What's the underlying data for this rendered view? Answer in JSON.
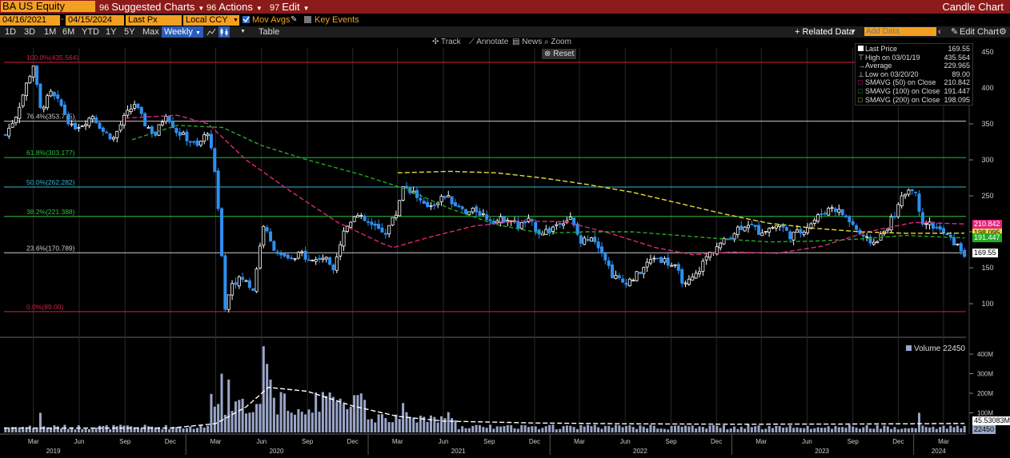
{
  "toolbar": {
    "ticker": "BA US Equity",
    "suggested_charts": "Suggested Charts",
    "suggested_num": "96",
    "actions": "Actions",
    "actions_num": "96",
    "edit": "Edit",
    "edit_num": "97",
    "chart_type": "Candle Chart"
  },
  "params": {
    "start_date": "04/16/2021",
    "end_date": "04/15/2024",
    "price_field": "Last Px",
    "currency": "Local CCY",
    "mov_avgs": "Mov Avgs",
    "key_events": "Key Events"
  },
  "ranges": [
    "1D",
    "3D",
    "1M",
    "6M",
    "YTD",
    "1Y",
    "5Y",
    "Max"
  ],
  "period": "Weekly",
  "table_label": "Table",
  "related_data": "+ Related Data",
  "add_data_placeholder": "Add Data",
  "edit_chart": "Edit Chart",
  "chart_tools": [
    "Track",
    "Annotate",
    "News",
    "Zoom"
  ],
  "reset_label": "Reset",
  "legend": {
    "last_price": {
      "label": "Last Price",
      "value": "169.55"
    },
    "high": {
      "label": "High on 03/01/19",
      "value": "435.564"
    },
    "average": {
      "label": "Average",
      "value": "229.965"
    },
    "low": {
      "label": "Low on 03/20/20",
      "value": "89.00"
    },
    "sma50": {
      "label": "SMAVG (50)  on Close",
      "value": "210.842",
      "color": "#e0267d"
    },
    "sma100": {
      "label": "SMAVG (100)  on Close",
      "value": "191.447",
      "color": "#22aa22"
    },
    "sma200": {
      "label": "SMAVG (200)  on Close",
      "value": "198.095",
      "color": "#e8d840"
    }
  },
  "volume_legend": {
    "label": "Volume",
    "value": "22450"
  },
  "price_badges": {
    "sma50": "210.842",
    "sma200": "198.095",
    "sma100": "191.447",
    "last": "169.55"
  },
  "volume_badges": {
    "avg": "45.53083M",
    "last": "22450"
  },
  "colors": {
    "up": "#ffffff",
    "down": "#2f8ff0",
    "topbar": "#8b1a1a",
    "accent": "#f3a021"
  },
  "chart_data": {
    "type": "candlestick",
    "frequency": "weekly",
    "x_range": [
      "2019-01-01",
      "2024-04-15"
    ],
    "ylim": [
      70,
      460
    ],
    "y_ticks": [
      100,
      150,
      200,
      250,
      300,
      350,
      400,
      450
    ],
    "volume_ticks": [
      "100M",
      "200M",
      "300M",
      "400M"
    ],
    "volume_ylim_millions": [
      0,
      450
    ],
    "x_month_ticks": [
      "Mar",
      "Jun",
      "Sep",
      "Dec",
      "Mar",
      "Jun",
      "Sep",
      "Dec",
      "Mar",
      "Jun",
      "Sep",
      "Dec",
      "Mar",
      "Jun",
      "Sep",
      "Dec",
      "Mar",
      "Jun",
      "Sep",
      "Dec",
      "Mar"
    ],
    "x_month_dates": [
      "2019-03",
      "2019-06",
      "2019-09",
      "2019-12",
      "2020-03",
      "2020-06",
      "2020-09",
      "2020-12",
      "2021-03",
      "2021-06",
      "2021-09",
      "2021-12",
      "2022-03",
      "2022-06",
      "2022-09",
      "2022-12",
      "2023-03",
      "2023-06",
      "2023-09",
      "2023-12",
      "2024-03"
    ],
    "x_year_ticks": [
      "2019",
      "2020",
      "2021",
      "2022",
      "2023",
      "2024"
    ],
    "x_year_dates": [
      "2019-04-10",
      "2020-07-01",
      "2021-07-01",
      "2022-07-01",
      "2023-07-01",
      "2024-02-20"
    ],
    "fibonacci": [
      {
        "label": "100.0%(435.564)",
        "value": 435.564,
        "color": "#d02040"
      },
      {
        "label": "76.4%(353.775)",
        "value": 353.775,
        "color": "#cccccc"
      },
      {
        "label": "61.8%(303.177)",
        "value": 303.177,
        "color": "#20c040"
      },
      {
        "label": "50.0%(262.282)",
        "value": 262.282,
        "color": "#30b8d0"
      },
      {
        "label": "38.2%(221.388)",
        "value": 221.388,
        "color": "#30c040"
      },
      {
        "label": "23.6%(170.789)",
        "value": 170.789,
        "color": "#cccccc"
      },
      {
        "label": "0.0%(89.00)",
        "value": 89.0,
        "color": "#d02040"
      }
    ],
    "close_path": [
      [
        "2019-01-04",
        335
      ],
      [
        "2019-01-25",
        362
      ],
      [
        "2019-02-15",
        405
      ],
      [
        "2019-03-01",
        432
      ],
      [
        "2019-03-15",
        370
      ],
      [
        "2019-04-05",
        392
      ],
      [
        "2019-04-26",
        375
      ],
      [
        "2019-05-17",
        345
      ],
      [
        "2019-06-07",
        350
      ],
      [
        "2019-06-28",
        362
      ],
      [
        "2019-07-19",
        340
      ],
      [
        "2019-08-09",
        330
      ],
      [
        "2019-08-30",
        358
      ],
      [
        "2019-09-20",
        378
      ],
      [
        "2019-10-11",
        350
      ],
      [
        "2019-11-01",
        335
      ],
      [
        "2019-11-22",
        365
      ],
      [
        "2019-12-13",
        340
      ],
      [
        "2020-01-03",
        330
      ],
      [
        "2020-01-24",
        318
      ],
      [
        "2020-02-14",
        340
      ],
      [
        "2020-02-28",
        285
      ],
      [
        "2020-03-13",
        170
      ],
      [
        "2020-03-20",
        95
      ],
      [
        "2020-04-03",
        130
      ],
      [
        "2020-04-24",
        135
      ],
      [
        "2020-05-15",
        120
      ],
      [
        "2020-06-05",
        210
      ],
      [
        "2020-06-19",
        185
      ],
      [
        "2020-07-10",
        165
      ],
      [
        "2020-07-31",
        160
      ],
      [
        "2020-08-21",
        170
      ],
      [
        "2020-09-11",
        160
      ],
      [
        "2020-10-02",
        165
      ],
      [
        "2020-10-23",
        152
      ],
      [
        "2020-11-13",
        200
      ],
      [
        "2020-12-04",
        225
      ],
      [
        "2020-12-25",
        215
      ],
      [
        "2021-01-15",
        205
      ],
      [
        "2021-02-05",
        200
      ],
      [
        "2021-02-26",
        225
      ],
      [
        "2021-03-12",
        265
      ],
      [
        "2021-04-02",
        255
      ],
      [
        "2021-04-23",
        235
      ],
      [
        "2021-05-14",
        240
      ],
      [
        "2021-06-04",
        250
      ],
      [
        "2021-06-25",
        238
      ],
      [
        "2021-07-16",
        225
      ],
      [
        "2021-08-06",
        230
      ],
      [
        "2021-08-27",
        220
      ],
      [
        "2021-09-17",
        215
      ],
      [
        "2021-10-08",
        220
      ],
      [
        "2021-10-29",
        208
      ],
      [
        "2021-11-19",
        215
      ],
      [
        "2021-12-10",
        200
      ],
      [
        "2021-12-31",
        202
      ],
      [
        "2022-01-21",
        215
      ],
      [
        "2022-02-11",
        218
      ],
      [
        "2022-03-04",
        185
      ],
      [
        "2022-03-25",
        195
      ],
      [
        "2022-04-15",
        175
      ],
      [
        "2022-05-06",
        140
      ],
      [
        "2022-05-27",
        130
      ],
      [
        "2022-06-17",
        135
      ],
      [
        "2022-07-08",
        150
      ],
      [
        "2022-07-29",
        165
      ],
      [
        "2022-08-19",
        160
      ],
      [
        "2022-09-09",
        150
      ],
      [
        "2022-09-30",
        125
      ],
      [
        "2022-10-21",
        140
      ],
      [
        "2022-11-11",
        165
      ],
      [
        "2022-12-02",
        180
      ],
      [
        "2022-12-23",
        190
      ],
      [
        "2023-01-13",
        205
      ],
      [
        "2023-02-03",
        212
      ],
      [
        "2023-02-24",
        200
      ],
      [
        "2023-03-17",
        205
      ],
      [
        "2023-04-07",
        210
      ],
      [
        "2023-04-28",
        195
      ],
      [
        "2023-05-19",
        200
      ],
      [
        "2023-06-09",
        212
      ],
      [
        "2023-06-30",
        225
      ],
      [
        "2023-07-21",
        235
      ],
      [
        "2023-08-11",
        225
      ],
      [
        "2023-09-01",
        210
      ],
      [
        "2023-09-22",
        190
      ],
      [
        "2023-10-13",
        185
      ],
      [
        "2023-11-03",
        200
      ],
      [
        "2023-11-24",
        225
      ],
      [
        "2023-12-15",
        255
      ],
      [
        "2023-12-29",
        262
      ],
      [
        "2024-01-05",
        250
      ],
      [
        "2024-01-19",
        215
      ],
      [
        "2024-02-09",
        208
      ],
      [
        "2024-03-01",
        198
      ],
      [
        "2024-03-22",
        185
      ],
      [
        "2024-04-12",
        169.55
      ]
    ],
    "series": [
      {
        "name": "SMAVG (50)  on Close",
        "color": "#e0267d",
        "dash": "6,3",
        "points": [
          [
            "2019-09-01",
            358
          ],
          [
            "2019-12-15",
            362
          ],
          [
            "2020-02-15",
            350
          ],
          [
            "2020-05-01",
            300
          ],
          [
            "2020-08-01",
            255
          ],
          [
            "2020-11-01",
            213
          ],
          [
            "2021-02-01",
            183
          ],
          [
            "2021-02-20",
            178
          ],
          [
            "2021-05-01",
            192
          ],
          [
            "2021-08-01",
            208
          ],
          [
            "2021-11-01",
            215
          ],
          [
            "2022-02-01",
            214
          ],
          [
            "2022-05-01",
            198
          ],
          [
            "2022-08-01",
            178
          ],
          [
            "2022-10-15",
            168
          ],
          [
            "2023-01-01",
            172
          ],
          [
            "2023-04-01",
            170
          ],
          [
            "2023-07-01",
            180
          ],
          [
            "2023-10-01",
            200
          ],
          [
            "2024-01-01",
            213
          ],
          [
            "2024-04-12",
            210.842
          ]
        ]
      },
      {
        "name": "SMAVG (100)  on Close",
        "color": "#22aa22",
        "dash": "5,3",
        "points": [
          [
            "2019-09-15",
            328
          ],
          [
            "2019-12-15",
            348
          ],
          [
            "2020-03-15",
            345
          ],
          [
            "2020-06-01",
            320
          ],
          [
            "2020-09-01",
            300
          ],
          [
            "2020-12-15",
            280
          ],
          [
            "2021-03-15",
            260
          ],
          [
            "2021-06-15",
            232
          ],
          [
            "2021-09-15",
            210
          ],
          [
            "2021-12-15",
            198
          ],
          [
            "2022-03-15",
            200
          ],
          [
            "2022-06-15",
            200
          ],
          [
            "2022-09-15",
            195
          ],
          [
            "2022-12-15",
            190
          ],
          [
            "2023-03-15",
            186
          ],
          [
            "2023-06-15",
            187
          ],
          [
            "2023-09-15",
            190
          ],
          [
            "2023-12-15",
            195
          ],
          [
            "2024-04-12",
            191.447
          ]
        ]
      },
      {
        "name": "SMAVG (200)  on Close",
        "color": "#e8d840",
        "dash": "6,3",
        "points": [
          [
            "2021-03-01",
            282
          ],
          [
            "2021-06-15",
            284
          ],
          [
            "2021-09-15",
            282
          ],
          [
            "2021-12-15",
            275
          ],
          [
            "2022-03-15",
            266
          ],
          [
            "2022-06-15",
            255
          ],
          [
            "2022-09-15",
            240
          ],
          [
            "2022-12-15",
            225
          ],
          [
            "2023-03-15",
            212
          ],
          [
            "2023-06-15",
            205
          ],
          [
            "2023-09-15",
            200
          ],
          [
            "2023-12-15",
            198
          ],
          [
            "2024-04-12",
            198.095
          ]
        ]
      },
      {
        "name": "Volume average",
        "color": "#ffffff",
        "dash": "6,3",
        "axis": "volume",
        "points": [
          [
            "2019-01-01",
            22
          ],
          [
            "2019-12-01",
            22
          ],
          [
            "2020-03-01",
            45
          ],
          [
            "2020-05-01",
            130
          ],
          [
            "2020-06-15",
            230
          ],
          [
            "2020-09-01",
            210
          ],
          [
            "2020-12-01",
            135
          ],
          [
            "2021-03-01",
            82
          ],
          [
            "2021-06-01",
            58
          ],
          [
            "2021-12-01",
            48
          ],
          [
            "2022-06-01",
            44
          ],
          [
            "2023-01-01",
            42
          ],
          [
            "2023-09-01",
            43
          ],
          [
            "2024-04-12",
            45.53
          ]
        ]
      }
    ],
    "volume_spikes": [
      [
        "2019-03-15",
        100
      ],
      [
        "2020-03-13",
        300
      ],
      [
        "2020-03-27",
        270
      ],
      [
        "2020-06-05",
        440
      ],
      [
        "2020-06-12",
        350
      ],
      [
        "2020-06-19",
        270
      ],
      [
        "2020-12-04",
        190
      ],
      [
        "2021-03-12",
        150
      ],
      [
        "2024-01-12",
        100
      ]
    ]
  }
}
